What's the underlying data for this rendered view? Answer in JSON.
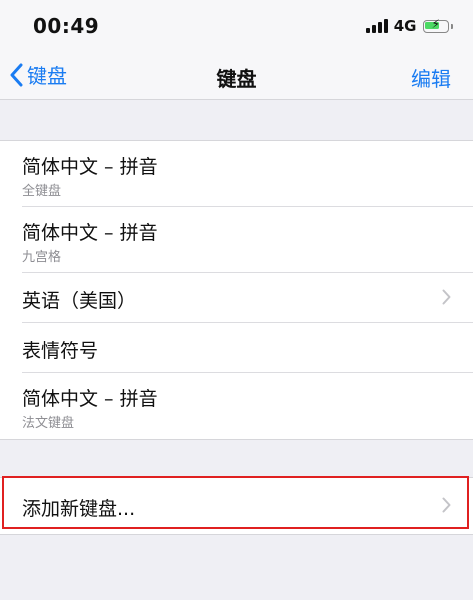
{
  "status_bar": {
    "time": "00:49",
    "network": "4G",
    "battery_level": 0.7,
    "battery_charging": true
  },
  "nav": {
    "back_label": "键盘",
    "title": "键盘",
    "edit_label": "编辑"
  },
  "keyboards": [
    {
      "title": "简体中文 – 拼音",
      "subtitle": "全键盘"
    },
    {
      "title": "简体中文 – 拼音",
      "subtitle": "九宫格"
    },
    {
      "title": "英语（美国）"
    },
    {
      "title": "表情符号"
    },
    {
      "title": "简体中文 – 拼音",
      "subtitle": "法文键盘"
    }
  ],
  "add_keyboard": {
    "label": "添加新键盘..."
  },
  "colors": {
    "accent": "#1a7cf2",
    "highlight": "#e02020",
    "battery": "#4cd964"
  },
  "icons": {
    "back": "chevron-left-icon",
    "disclosure": "chevron-right-icon",
    "signal": "cellular-signal-icon",
    "battery": "battery-charging-icon"
  }
}
